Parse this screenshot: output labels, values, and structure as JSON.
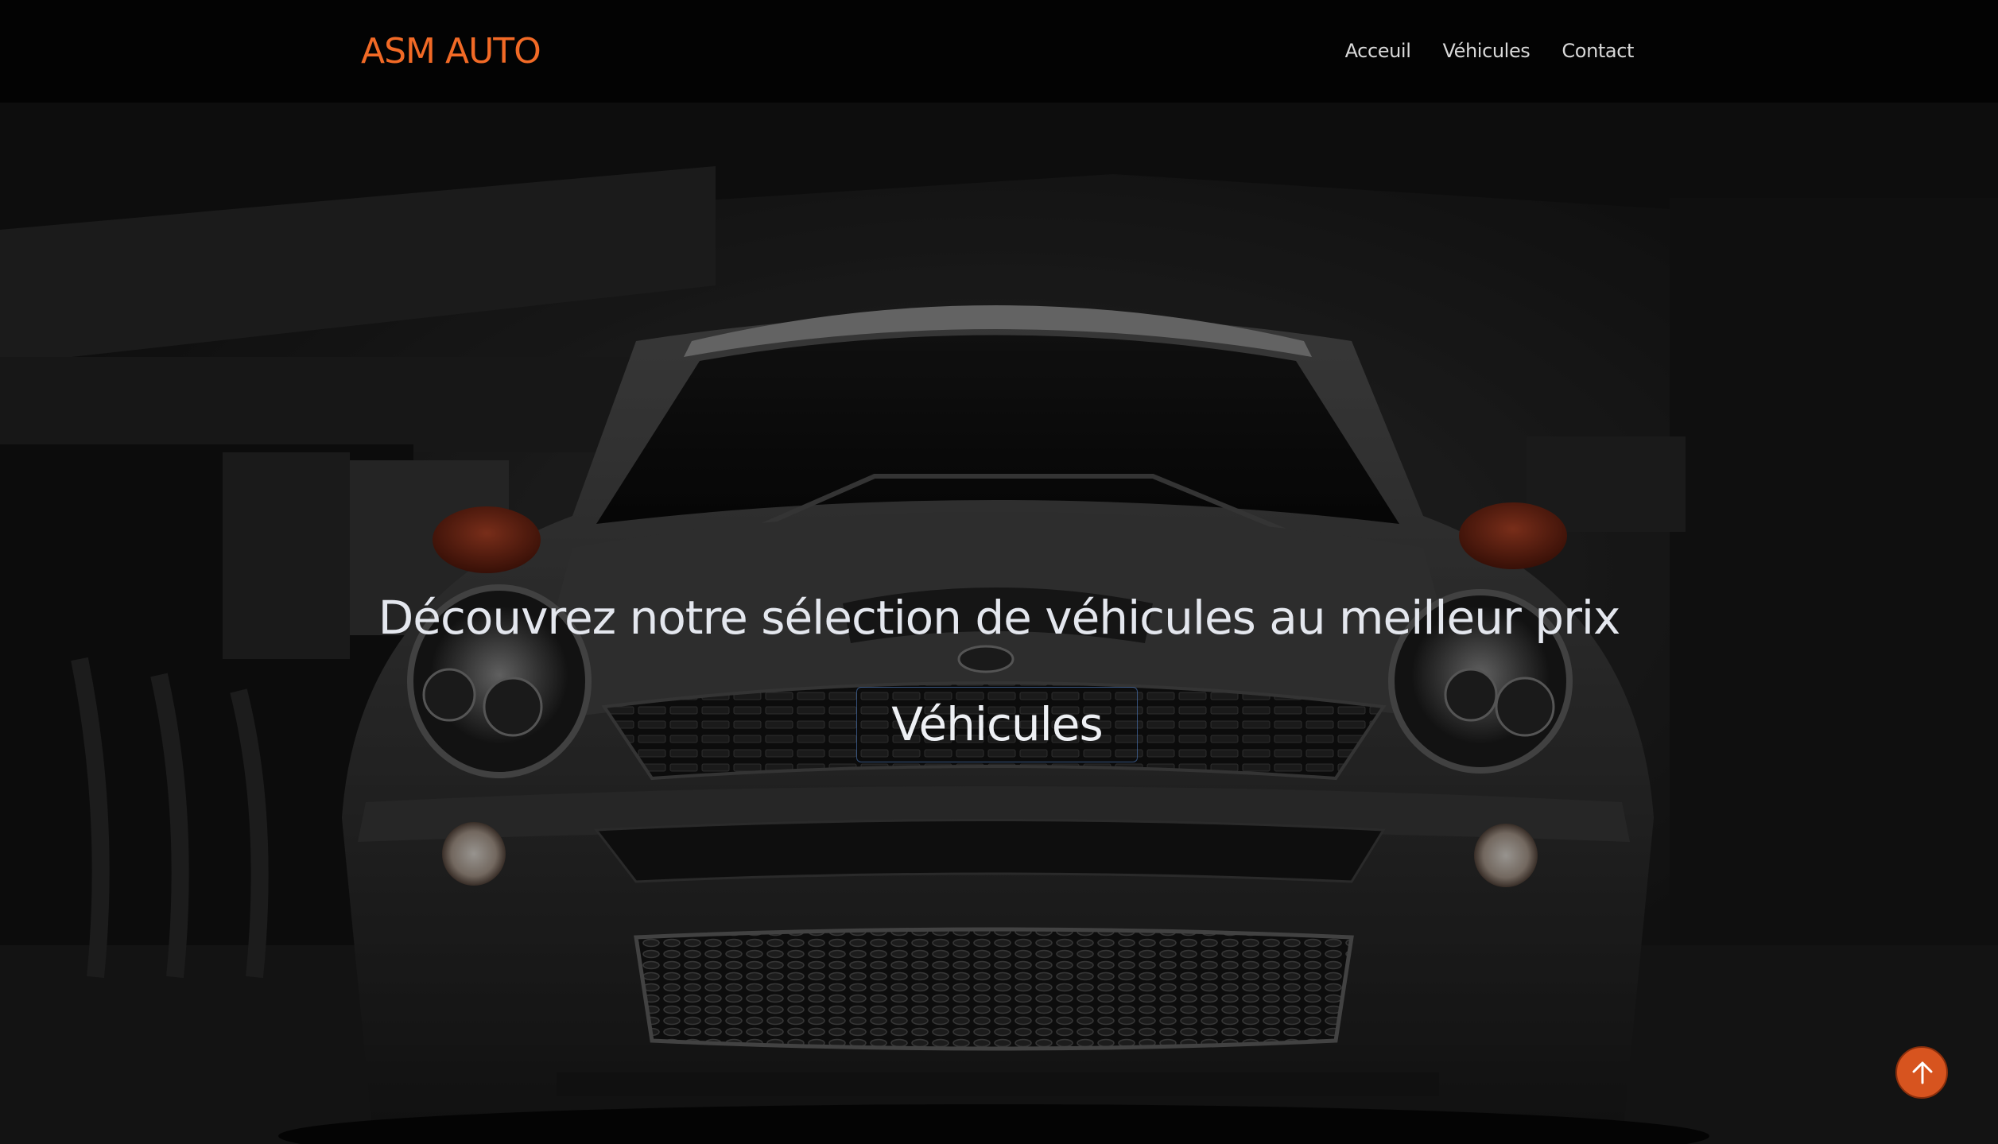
{
  "navbar": {
    "brand": "ASM AUTO",
    "links": [
      "Acceuil",
      "Véhicules",
      "Contact"
    ]
  },
  "hero": {
    "headline": "Découvrez notre sélection de véhicules au meilleur prix",
    "cta_label": "Véhicules"
  },
  "back_to_top": {
    "icon": "arrow-up-icon"
  },
  "colors": {
    "brand_accent": "#f26a26",
    "navbar_bg": "#030303",
    "back_to_top_bg": "#d7541f"
  }
}
